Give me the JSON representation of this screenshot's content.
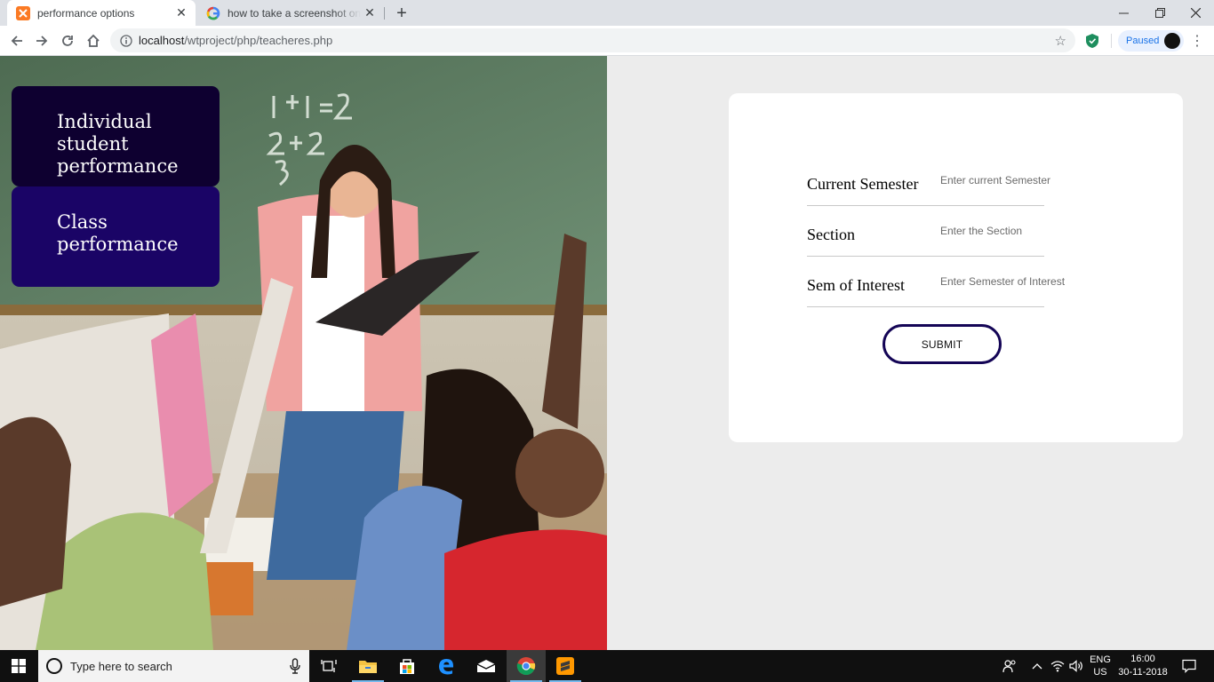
{
  "browser": {
    "tabs": [
      {
        "title": "performance options",
        "icon": "xampp-icon",
        "active": true
      },
      {
        "title": "how to take a screenshot on a laptop",
        "icon": "google-icon",
        "active": false
      }
    ],
    "url_host": "localhost",
    "url_path": "/wtproject/php/teacheres.php",
    "profile_status": "Paused"
  },
  "sidebar": {
    "items": [
      {
        "label": "Individual student performance"
      },
      {
        "label": "Class performance"
      }
    ]
  },
  "form": {
    "fields": [
      {
        "label": "Current Semester",
        "placeholder": "Enter current Semester",
        "value": ""
      },
      {
        "label": "Section",
        "placeholder": "Enter the Section",
        "value": ""
      },
      {
        "label": "Sem of Interest",
        "placeholder": "Enter Semester of Interest",
        "value": ""
      }
    ],
    "submit_label": "SUBMIT"
  },
  "taskbar": {
    "search_placeholder": "Type here to search",
    "apps": [
      "task-view",
      "file-explorer",
      "microsoft-store",
      "edge",
      "mail",
      "chrome",
      "sublime-text"
    ],
    "language": [
      "ENG",
      "US"
    ],
    "time": "16:00",
    "date": "30-11-2018"
  },
  "colors": {
    "menu_dark": "#0e0030",
    "menu_active": "#1a0466",
    "submit_border": "#140556",
    "page_bg": "#ececec"
  }
}
